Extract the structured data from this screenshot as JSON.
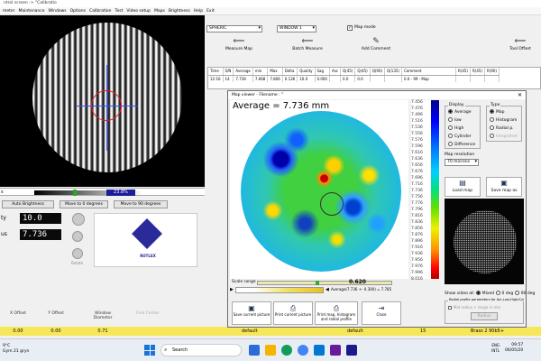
{
  "window": {
    "title": "ntrol screen -> \"Calibratio"
  },
  "menu": [
    "meter",
    "Maintenance",
    "Windows",
    "Options",
    "Calibration",
    "Test",
    "Video setup",
    "Maps",
    "Brightness",
    "Help",
    "Exit"
  ],
  "camera_panel": {
    "scale_label": "s",
    "scale_percent": "23.8%",
    "buttons": {
      "auto": "Auto Brightness",
      "move0": "Move to 0 degrees",
      "move90": "Move to 90 degrees"
    },
    "values": [
      {
        "label": "ty",
        "value": "10.0"
      },
      {
        "label": "us",
        "value": "7.736"
      }
    ],
    "logo_text": "ROTLEX",
    "rotate_label": "Rotate"
  },
  "toolbar": {
    "mode_select": "SPHERIC",
    "window_select": "WINDOW 1",
    "map_mode_label": "Map mode",
    "map_mode_checked": "✓",
    "buttons": [
      {
        "label": "Measure Map"
      },
      {
        "label": "Batch Measure"
      },
      {
        "label": "Add Comment"
      },
      {
        "label": "Tool Offset"
      }
    ]
  },
  "results_table": {
    "headers": [
      "Time",
      "S/N",
      "Average",
      "min",
      "Max",
      "Delta",
      "Quality",
      "Sag",
      "Asc",
      "Q(45)",
      "Q(45)",
      "Q(90)",
      "Q(135)",
      "Comment",
      "R(45)",
      "R(45)",
      "R(90)"
    ],
    "rows": [
      [
        "12:16",
        "14",
        "7.736",
        "7.668",
        "7.806",
        "0.136",
        "10.0",
        "0.000",
        "",
        "0.0",
        "0.0",
        "",
        "",
        "0.0 - 99 - Map",
        "",
        "",
        ""
      ]
    ]
  },
  "map_viewer": {
    "title": "Map viewer - Filename : ''",
    "close_icon": "✕",
    "average_text": "Average = 7.736 mm",
    "colorbar_ticks": [
      "7.456",
      "7.476",
      "7.496",
      "7.516",
      "7.536",
      "7.556",
      "7.576",
      "7.596",
      "7.616",
      "7.636",
      "7.656",
      "7.676",
      "7.696",
      "7.716",
      "7.736",
      "7.756",
      "7.776",
      "7.796",
      "7.816",
      "7.836",
      "7.856",
      "7.876",
      "7.896",
      "7.916",
      "7.936",
      "7.956",
      "7.976",
      "7.996",
      "8.016"
    ],
    "display": {
      "title": "Display",
      "options": [
        {
          "label": "Average",
          "selected": true
        },
        {
          "label": "low",
          "selected": false
        },
        {
          "label": "High",
          "selected": false
        },
        {
          "label": "Cylinder",
          "selected": false
        },
        {
          "label": "Difference",
          "selected": false
        }
      ]
    },
    "type": {
      "title": "Type",
      "options": [
        {
          "label": "Map",
          "selected": true
        },
        {
          "label": "Histogram",
          "selected": false
        },
        {
          "label": "Radial p.",
          "selected": false
        },
        {
          "label": "Integrated",
          "selected": false
        }
      ]
    },
    "map_resolution_label": "Map resolution",
    "map_resolution_value": "70 microns",
    "load_map": "Load map",
    "save_map": "Save map as",
    "scale_range_label": "Scale range",
    "scale_range_value": "0.620",
    "range_text": "Average(7.736 +- 0.300) = 7.785",
    "show_video_label": "Show video at:",
    "show_video_options": [
      {
        "label": "Mixed",
        "selected": true
      },
      {
        "label": "0 deg",
        "selected": false
      },
      {
        "label": "90 deg",
        "selected": false
      }
    ],
    "radial_title": "Radial profile parameters for Avr,Low,High/Cyl",
    "radial_row": "Mid radius    > range in mm",
    "radial_button": "Radius",
    "bottom_buttons": [
      {
        "label": "Save current picture"
      },
      {
        "label": "Print current picture"
      },
      {
        "label": "Print map, histogram and radial profile"
      },
      {
        "label": "Close"
      }
    ]
  },
  "bottom_panel": {
    "columns": [
      {
        "label": "X Offset",
        "value": "0.00"
      },
      {
        "label": "Y Offset",
        "value": "0.00"
      },
      {
        "label": "Window Diameter",
        "value": "0.71"
      },
      {
        "label": "Find Center",
        "value": ""
      }
    ]
  },
  "status": {
    "fields": [
      "default",
      "default",
      "15",
      "Brass 2 90b5+"
    ]
  },
  "taskbar": {
    "weather_temp": "9°C",
    "weather_desc": "Gym 21 gryn",
    "search_placeholder": "Search",
    "lang": "ENG INTL",
    "time": "09:57",
    "date": "06/05/20"
  }
}
